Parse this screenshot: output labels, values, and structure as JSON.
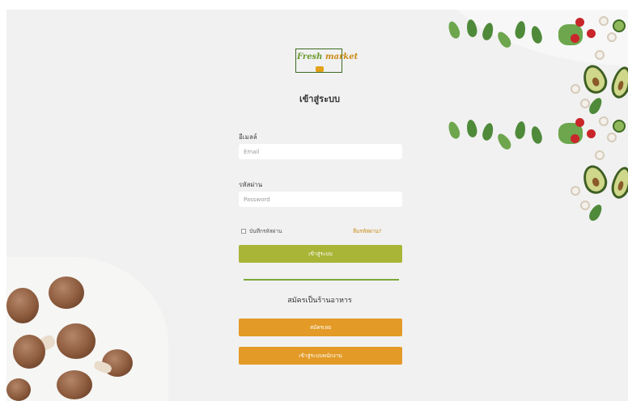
{
  "brand": {
    "logo_word1": "Fresh",
    "logo_word2": "market"
  },
  "page_title": "เข้าสู่ระบบ",
  "form": {
    "email_label": "อีเมลล์",
    "email_placeholder": "Email",
    "password_label": "รหัสผ่าน",
    "password_placeholder": "Password",
    "remember_label": "บันทึกรหัสผ่าน",
    "remember_checked": false,
    "forgot_label": "ลืมรหัสผ่าน?",
    "login_button": "เข้าสู่ระบบ"
  },
  "register": {
    "heading": "สมัครเป็นร้านอาหาร",
    "register_button": "สมัครเลย",
    "staff_login_button": "เข้าสู่ระบบพนักงาน"
  },
  "colors": {
    "login_button": "#a8b536",
    "secondary_button": "#e39a26",
    "divider": "#7aa93b",
    "link": "#c88a14"
  },
  "icons": {
    "remember_checkbox": "checkbox-icon"
  }
}
